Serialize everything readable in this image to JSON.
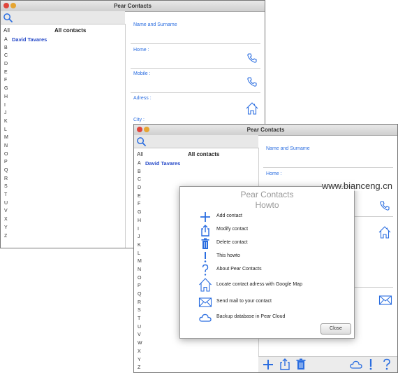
{
  "back_window": {
    "title": "Pear Contacts",
    "all_label": "All",
    "all_contacts": "All contacts",
    "contact": "David Tavares",
    "letters": [
      "A",
      "B",
      "C",
      "D",
      "E",
      "F",
      "G",
      "H",
      "I",
      "J",
      "K",
      "L",
      "M",
      "N",
      "O",
      "P",
      "Q",
      "R",
      "S",
      "T",
      "U",
      "V",
      "X",
      "Y",
      "Z"
    ],
    "labels": {
      "name": "Name and Surname",
      "home": "Home :",
      "mobile": "Mobile :",
      "address": "Adress :",
      "city": "City :"
    }
  },
  "front_window": {
    "title": "Pear Contacts",
    "all_label": "All",
    "all_contacts": "All contacts",
    "contact": "David Tavares",
    "letters": [
      "A",
      "B",
      "C",
      "D",
      "E",
      "F",
      "G",
      "H",
      "I",
      "J",
      "K",
      "L",
      "M",
      "N",
      "O",
      "P",
      "Q",
      "R",
      "S",
      "T",
      "U",
      "V",
      "W",
      "X",
      "Y",
      "Z"
    ],
    "labels": {
      "name": "Name and Surname",
      "home": "Home :"
    }
  },
  "dialog": {
    "title_line1": "Pear Contacts",
    "title_line2": "Howto",
    "items": [
      {
        "icon": "plus-icon",
        "text": "Add contact"
      },
      {
        "icon": "share-icon",
        "text": "Modify contact"
      },
      {
        "icon": "trash-icon",
        "text": "Delete contact"
      },
      {
        "icon": "exclamation-icon",
        "text": "This howto"
      },
      {
        "icon": "question-icon",
        "text": "About Pear Contacts"
      },
      {
        "icon": "house-icon",
        "text": "Locate contact adress with Google Map"
      },
      {
        "icon": "mail-icon",
        "text": "Send mail to your contact"
      },
      {
        "icon": "cloud-icon",
        "text": "Backup database in Pear Cloud"
      }
    ],
    "close_label": "Close"
  },
  "watermark": "www.bianceng.cn",
  "colors": {
    "accent": "#2a6de0",
    "contact": "#2448c8"
  }
}
